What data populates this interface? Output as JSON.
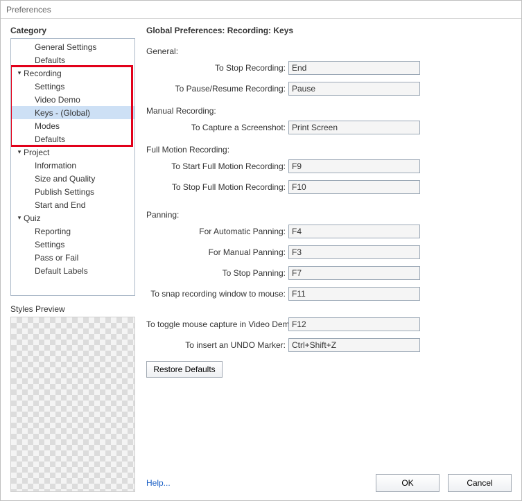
{
  "window": {
    "title": "Preferences"
  },
  "left": {
    "category_label": "Category",
    "styles_preview_label": "Styles Preview"
  },
  "tree": {
    "general_settings": "General Settings",
    "defaults_top": "Defaults",
    "recording": "Recording",
    "recording_settings": "Settings",
    "recording_video_demo": "Video Demo",
    "recording_keys": "Keys - (Global)",
    "recording_modes": "Modes",
    "recording_defaults": "Defaults",
    "project": "Project",
    "project_information": "Information",
    "project_size_quality": "Size and Quality",
    "project_publish_settings": "Publish Settings",
    "project_start_end": "Start and End",
    "quiz": "Quiz",
    "quiz_reporting": "Reporting",
    "quiz_settings": "Settings",
    "quiz_pass_fail": "Pass or Fail",
    "quiz_default_labels": "Default Labels"
  },
  "panel": {
    "title": "Global Preferences: Recording: Keys",
    "general_label": "General:",
    "stop_recording_label": "To Stop Recording:",
    "stop_recording_value": "End",
    "pause_resume_label": "To Pause/Resume Recording:",
    "pause_resume_value": "Pause",
    "manual_label": "Manual Recording:",
    "capture_screenshot_label": "To Capture a Screenshot:",
    "capture_screenshot_value": "Print Screen",
    "fullmotion_label": "Full Motion Recording:",
    "start_fm_label": "To Start Full Motion Recording:",
    "start_fm_value": "F9",
    "stop_fm_label": "To Stop Full Motion Recording:",
    "stop_fm_value": "F10",
    "panning_label": "Panning:",
    "auto_pan_label": "For Automatic Panning:",
    "auto_pan_value": "F4",
    "manual_pan_label": "For Manual Panning:",
    "manual_pan_value": "F3",
    "stop_pan_label": "To Stop Panning:",
    "stop_pan_value": "F7",
    "snap_label": "To snap recording window to mouse:",
    "snap_value": "F11",
    "toggle_mouse_label": "To toggle mouse capture in Video Demo:",
    "toggle_mouse_value": "F12",
    "undo_label": "To insert an UNDO Marker:",
    "undo_value": "Ctrl+Shift+Z",
    "restore_defaults": "Restore Defaults"
  },
  "footer": {
    "help": "Help...",
    "ok": "OK",
    "cancel": "Cancel"
  }
}
